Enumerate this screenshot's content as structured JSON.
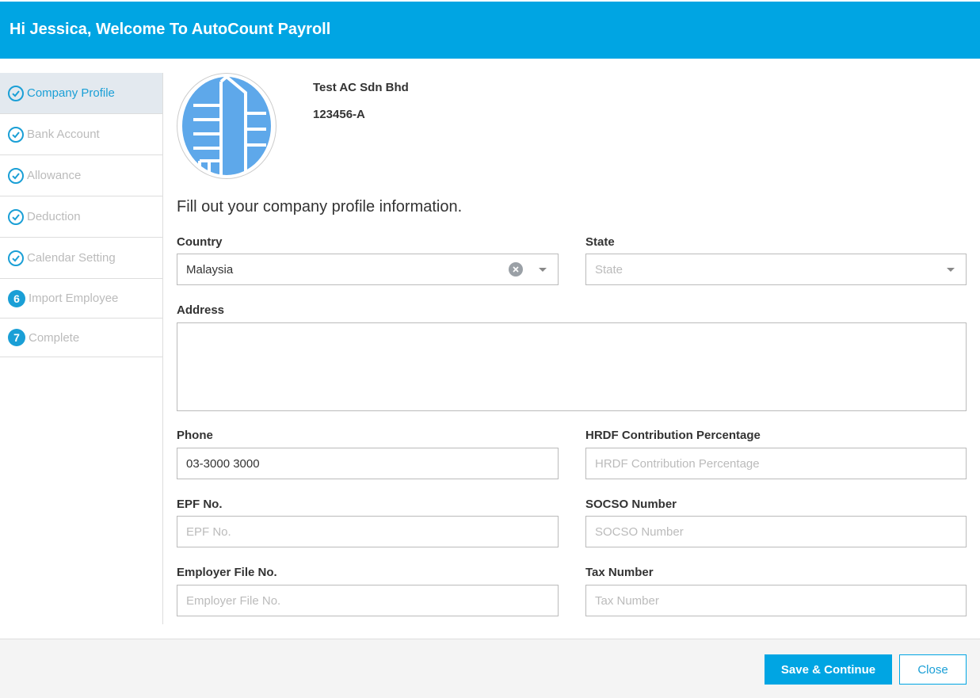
{
  "header": {
    "title": "Hi Jessica, Welcome To AutoCount Payroll"
  },
  "sidebar": {
    "steps": [
      {
        "label": "Company Profile",
        "state": "done",
        "active": true
      },
      {
        "label": "Bank Account",
        "state": "done"
      },
      {
        "label": "Allowance",
        "state": "done"
      },
      {
        "label": "Deduction",
        "state": "done"
      },
      {
        "label": "Calendar Setting",
        "state": "done"
      },
      {
        "label": "Import Employee",
        "state": "pending",
        "number": "6"
      },
      {
        "label": "Complete",
        "state": "pending",
        "number": "7"
      }
    ]
  },
  "company": {
    "name": "Test AC Sdn Bhd",
    "registration": "123456-A",
    "logo_icon": "building-icon"
  },
  "form": {
    "heading": "Fill out your company profile information.",
    "country": {
      "label": "Country",
      "value": "Malaysia"
    },
    "state": {
      "label": "State",
      "placeholder": "State"
    },
    "address": {
      "label": "Address",
      "value": ""
    },
    "phone": {
      "label": "Phone",
      "value": "03-3000 3000"
    },
    "hrdf": {
      "label": "HRDF Contribution Percentage",
      "placeholder": "HRDF Contribution Percentage"
    },
    "epf": {
      "label": "EPF No.",
      "placeholder": "EPF No."
    },
    "socso": {
      "label": "SOCSO Number",
      "placeholder": "SOCSO Number"
    },
    "employer_file": {
      "label": "Employer File No.",
      "placeholder": "Employer File No."
    },
    "tax": {
      "label": "Tax Number",
      "placeholder": "Tax Number"
    }
  },
  "footer": {
    "save_label": "Save & Continue",
    "close_label": "Close"
  },
  "colors": {
    "accent": "#00a5e3",
    "step_blue": "#1a9fd6",
    "active_step_bg": "#e3e9ef"
  }
}
